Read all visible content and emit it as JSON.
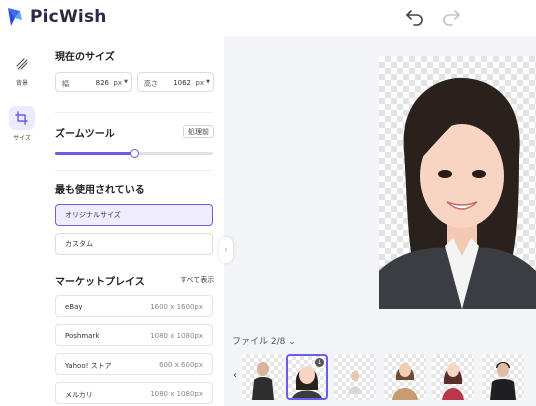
{
  "app": {
    "name": "PicWish"
  },
  "colors": {
    "accent": "#6c5ce7",
    "canvas_bg": "#f3f4f8"
  },
  "rail": {
    "items": [
      {
        "label": "背景",
        "icon": "background-pattern-icon"
      },
      {
        "label": "サイズ",
        "icon": "crop-icon",
        "active": true
      }
    ]
  },
  "size": {
    "title": "現在のサイズ",
    "width": {
      "label": "幅",
      "value": "826",
      "unit": "px"
    },
    "height": {
      "label": "高さ",
      "value": "1062",
      "unit": "px"
    }
  },
  "zoom": {
    "title": "ズームツール",
    "badge": "処理前",
    "value_fraction": 0.5
  },
  "most_used": {
    "title": "最も使用されている",
    "options": [
      {
        "label": "オリジナルサイズ",
        "selected": true
      },
      {
        "label": "カスタム",
        "selected": false
      }
    ]
  },
  "marketplace": {
    "title": "マーケットプレイス",
    "show_all": "すべて表示",
    "items": [
      {
        "name": "eBay",
        "dim": "1600 x 1600px"
      },
      {
        "name": "Poshmark",
        "dim": "1080 x 1080px"
      },
      {
        "name": "Yahoo! ストア",
        "dim": "600 x 600px"
      },
      {
        "name": "メルカリ",
        "dim": "1080 x 1080px"
      }
    ]
  },
  "canvas": {
    "file_counter": "ファイル 2/8"
  }
}
